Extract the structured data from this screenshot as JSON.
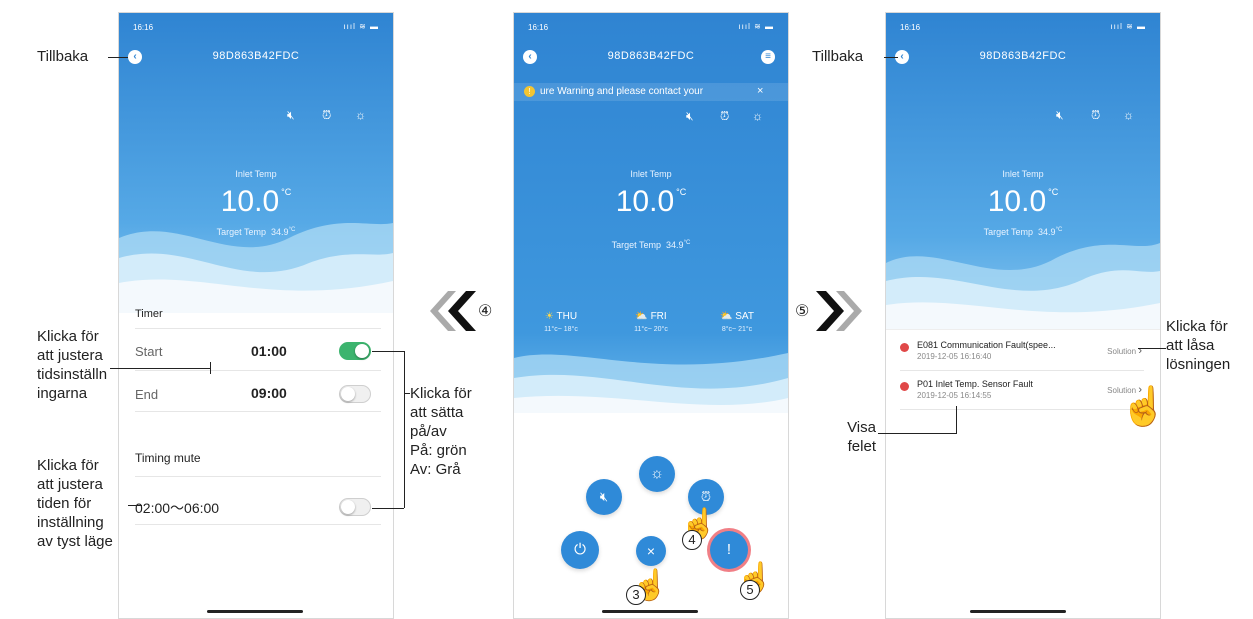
{
  "status": {
    "time": "16:16",
    "signal": "ıııl ≋ ▬"
  },
  "device_id": "98D863B42FDC",
  "reading": {
    "inlet_label": "Inlet Temp",
    "inlet_value": "10.0",
    "unit": "°C",
    "target_label": "Target Temp",
    "target_value": "34.9",
    "target_unit": "°C"
  },
  "screen1": {
    "timer_header": "Timer",
    "start_label": "Start",
    "start_time": "01:00",
    "end_label": "End",
    "end_time": "09:00",
    "mute_header": "Timing mute",
    "mute_range": "02:00～06:00",
    "toggles": {
      "start_on": true,
      "end_on": false,
      "mute_on": false
    }
  },
  "screen2": {
    "warning": "ure Warning and please contact your",
    "warning_close": "×",
    "weather": [
      {
        "day": "THU",
        "range": "11°c~ 18°c",
        "icon": "sun-icon"
      },
      {
        "day": "FRI",
        "range": "11°c~ 20°c",
        "icon": "cloud-sun-icon"
      },
      {
        "day": "SAT",
        "range": "8°c~ 21°c",
        "icon": "cloud-sun-icon"
      }
    ],
    "buttons": [
      "mute",
      "sun",
      "alarm",
      "power",
      "close",
      "fault"
    ]
  },
  "screen3": {
    "faults": [
      {
        "title": "E081 Communication Fault(spee...",
        "time": "2019-12-05 16:16:40",
        "action": "Solution"
      },
      {
        "title": "P01 Inlet Temp. Sensor Fault",
        "time": "2019-12-05 16:14:55",
        "action": "Solution"
      }
    ]
  },
  "annotations": {
    "back": "Tillbaka",
    "adjust_time": "Klicka för\natt justera\ntidsinställn\ningarna",
    "toggle_on_off": "Klicka för\natt sätta\npå/av\nPå: grön\nAv: Grå",
    "adjust_silent": "Klicka för\natt justera\ntiden för\ninställning\nav tyst läge",
    "lock_solution": "Klicka för\natt låsa\nlösningen",
    "show_fault": "Visa\nfelet",
    "nav_back_num": "④",
    "nav_fwd_num": "⑤",
    "tap_3": "3",
    "tap_4": "4",
    "tap_5": "5"
  },
  "colors": {
    "header_top": "#2f84d2",
    "header_bottom": "#5fb3ea",
    "toggle_on": "#3cb46e",
    "bubble": "#2f8ad8",
    "fault": "#e04848"
  }
}
